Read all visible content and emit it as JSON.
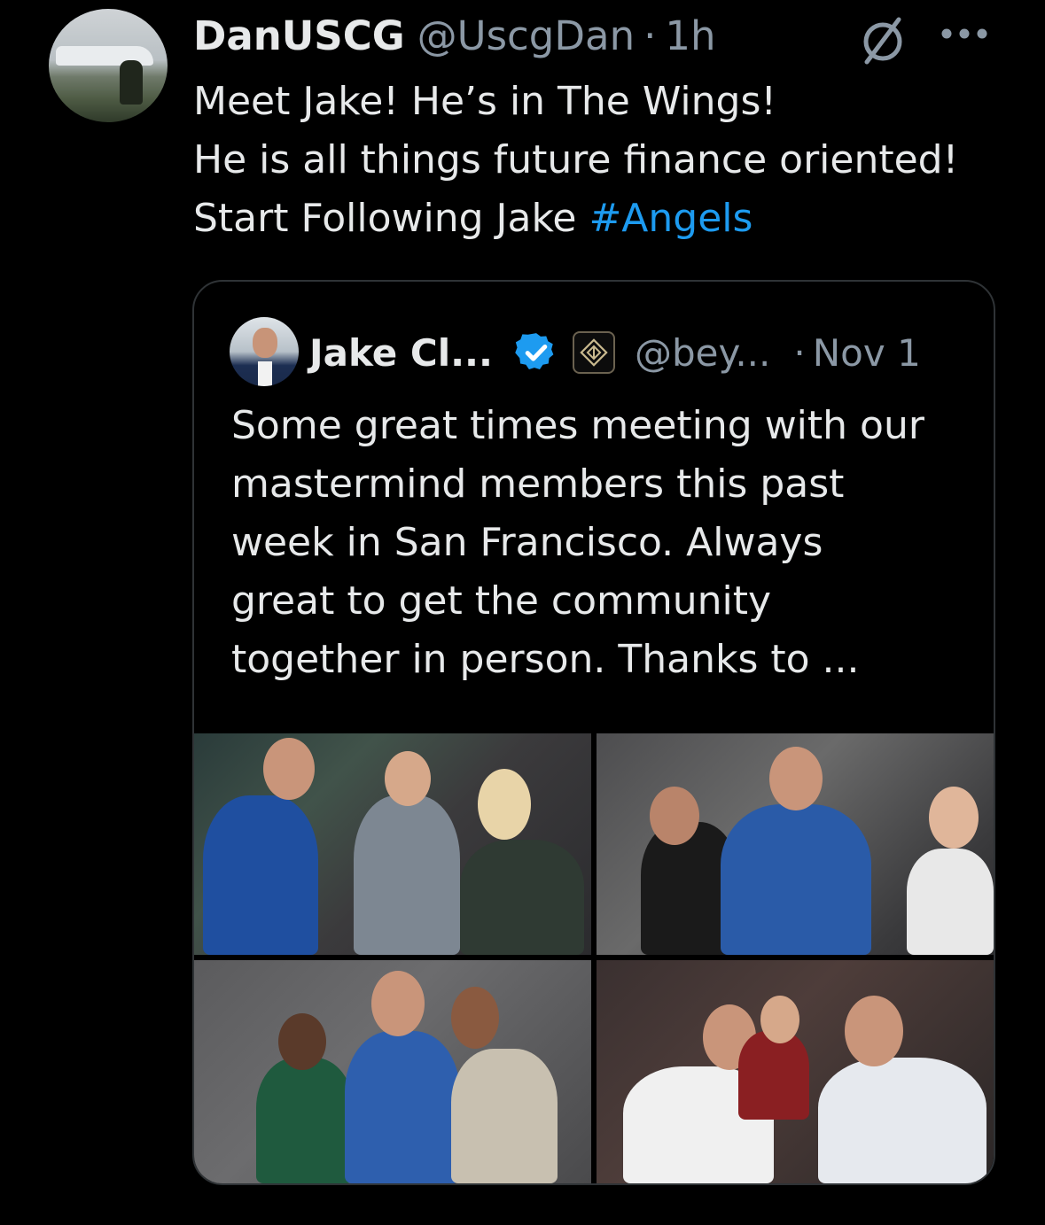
{
  "tweet": {
    "display_name": "DanUSCG",
    "handle": "@UscgDan",
    "separator": "·",
    "time": "1h",
    "text_lines": [
      "Meet Jake! He’s in The Wings!",
      "He is all things future finance oriented!",
      "Start Following Jake "
    ],
    "hashtag": "#Angels"
  },
  "quote": {
    "display_name": "Jake Cl...",
    "handle": "@bey...",
    "separator": "·",
    "time": "Nov 1",
    "text_lines": [
      "Some great times meeting with our",
      "mastermind members this past",
      "week in San Francisco. Always",
      "great to get the community",
      "together in person. Thanks to ..."
    ],
    "photos": [
      "photo-1",
      "photo-2",
      "photo-3",
      "photo-4"
    ]
  },
  "colors": {
    "background": "#000000",
    "text": "#e7e9ea",
    "secondary": "#8b98a5",
    "link": "#1d9bf0",
    "verified": "#1d9bf0",
    "border": "#2f3336"
  },
  "icons": {
    "verified": "verified-icon",
    "org_badge": "org-badge-icon",
    "no_entry": "no-entry-icon",
    "more": "more-icon"
  }
}
